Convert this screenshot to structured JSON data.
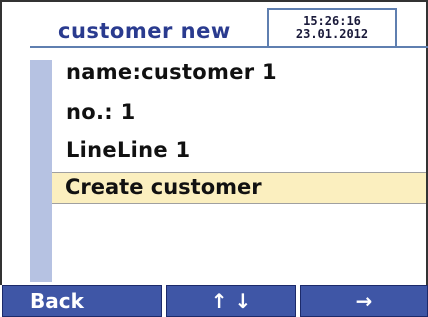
{
  "header": {
    "title": "customer new",
    "time": "15:26:16",
    "date": "23.01.2012"
  },
  "rows": [
    {
      "text": "name:customer 1"
    },
    {
      "text": "no.: 1"
    },
    {
      "text": "LineLine 1"
    }
  ],
  "selected_row": {
    "text": "Create customer"
  },
  "softkeys": [
    {
      "label": "Back"
    },
    {
      "label": "↑ ↓"
    },
    {
      "label": "→"
    }
  ],
  "colors": {
    "title": "#2a3b8f",
    "accent_bar": "#b6c2e2",
    "highlight": "#fbefbf",
    "softkey": "#3f56a6"
  }
}
